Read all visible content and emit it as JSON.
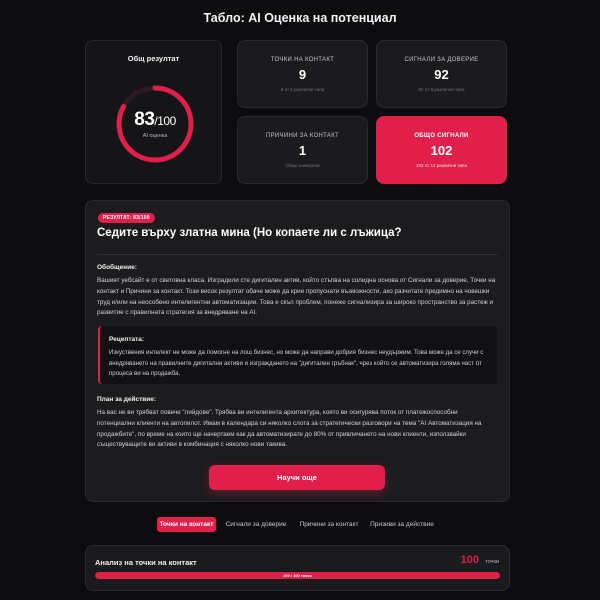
{
  "header": {
    "title": "Табло: AI Оценка на потенциал"
  },
  "score": {
    "label": "Общ резултат",
    "value": "83",
    "max": "/100",
    "sublabel": "AI оценка",
    "fraction": 0.83,
    "accent": "#e0204b"
  },
  "stats": [
    {
      "label": "Точки на контакт",
      "value": "9",
      "sub": "9 от 5 различни типа"
    },
    {
      "label": "Сигнали за доверие",
      "value": "92",
      "sub": "92 от 8 различни типа"
    },
    {
      "label": "Причини за контакт",
      "value": "1",
      "sub": "Общо намерени"
    },
    {
      "label": "Общо сигнали",
      "value": "102",
      "sub": "102 от 12 различни типа"
    }
  ],
  "main": {
    "badge": "РЕЗУЛТАТ: 83/100",
    "headline": "Седите върху златна мина (Но копаете ли с лъжица?",
    "summary_title": "Обобщение:",
    "summary_text": "Вашият уебсайт е от световна класа. Изградили сте дигитален актив, който стъпва на солидна основа от Сигнали за доверие, Точки на контакт и Причини за контакт. Този висок резултат обаче може да крие пропуснати възможности, ако разчитате предимно на човешки труд и/или на неособено интелигентни автоматизации. Това е скъп проблем, понеже сигнализира за широко пространство за растеж и развитие с правилната стратегия за внедряване на AI.",
    "recipe_title": "Рецептата:",
    "recipe_text": "Изкуствения интелект не може да помогне на лош бизнес, но може да направи добрия бизнес неудържим. Това може да се случи с внедряването на правилните дигитални активи и изграждането на \"дигитален гръбнак\", чрез който се автоматизира голяма част от процеса ви на продажба.",
    "plan_title": "План за действие:",
    "plan_text": "На вас не ви трябват повече \"лийдове\". Трябва ви интелигента архитектура, която ви осигурява поток от платежоспособни потенциални клиенти на автопилот. Имам в календара си няколко слота за стратегически разговори на тема \"AI Автоматизация на продажбите\", по време на които ще начертаем как да автоматизирате до 80% от привличането на нови клиенти, използвайки съществуващите ви активи в комбинация с няколко нови такива.",
    "cta_label": "Научи още"
  },
  "tabs": [
    {
      "label": "Точки на контакт",
      "active": true
    },
    {
      "label": "Сигнали за доверие",
      "active": false
    },
    {
      "label": "Причини за контакт",
      "active": false
    },
    {
      "label": "Призиви за действие",
      "active": false
    }
  ],
  "analysis": {
    "title": "Анализ на точки на контакт",
    "value": "100",
    "unit": "точки",
    "bar_label": "100 / 100 точки",
    "fraction": 1.0
  }
}
